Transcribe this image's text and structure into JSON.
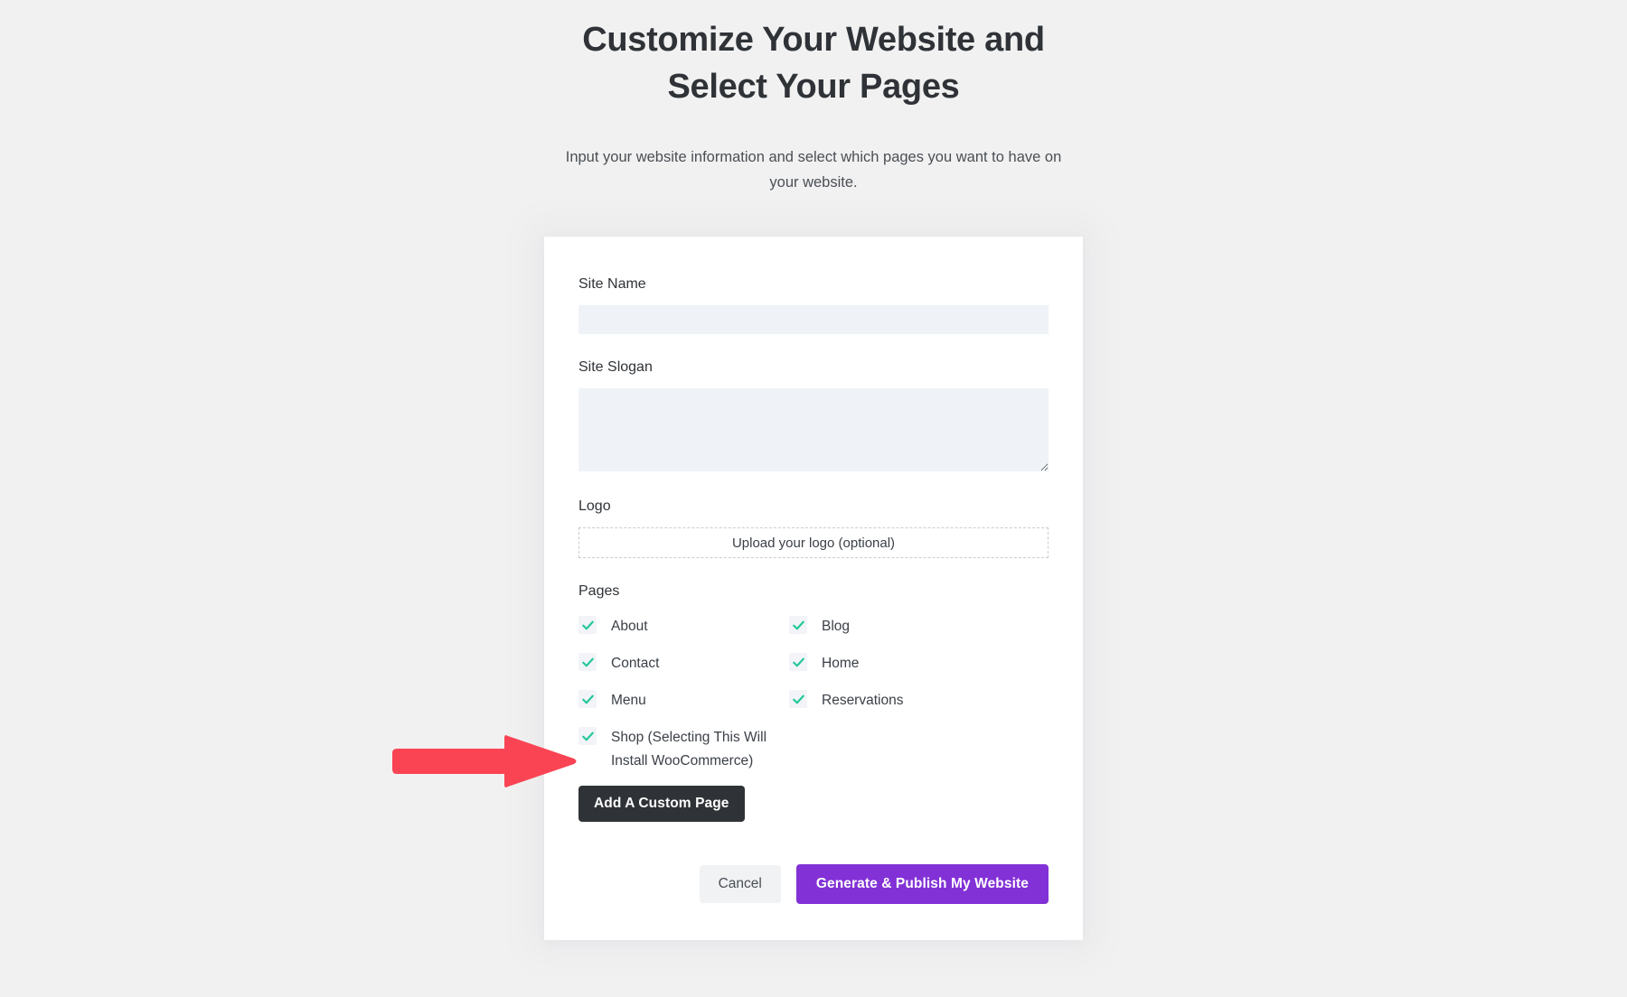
{
  "header": {
    "title": "Customize Your Website and Select Your Pages",
    "subtitle": "Input your website information and select which pages you want to have on your website."
  },
  "form": {
    "site_name": {
      "label": "Site Name",
      "value": "",
      "placeholder": ""
    },
    "site_slogan": {
      "label": "Site Slogan",
      "value": "",
      "placeholder": ""
    },
    "logo": {
      "label": "Logo",
      "upload_label": "Upload your logo (optional)"
    },
    "pages": {
      "label": "Pages",
      "items": [
        {
          "label": "About",
          "checked": true,
          "column": "left"
        },
        {
          "label": "Blog",
          "checked": true,
          "column": "right"
        },
        {
          "label": "Contact",
          "checked": true,
          "column": "left"
        },
        {
          "label": "Home",
          "checked": true,
          "column": "right"
        },
        {
          "label": "Menu",
          "checked": true,
          "column": "left"
        },
        {
          "label": "Reservations",
          "checked": true,
          "column": "right"
        },
        {
          "label": "Shop (Selecting This Will Install WooCommerce)",
          "checked": true,
          "column": "left"
        }
      ]
    },
    "add_custom_page_label": "Add A Custom Page"
  },
  "actions": {
    "cancel_label": "Cancel",
    "generate_label": "Generate & Publish My Website"
  },
  "annotation": {
    "type": "arrow-right",
    "target": "Shop (Selecting This Will Install WooCommerce)",
    "color": "#fa4454"
  },
  "colors": {
    "page_background": "#f1f1f1",
    "card_background": "#ffffff",
    "text_primary": "#2f3337",
    "text_secondary": "#4a4f55",
    "input_background": "#eff2f6",
    "checkbox_background": "#f2f4f8",
    "check_green": "#22c79a",
    "dark_button": "#2f3337",
    "cancel_button": "#f1f2f4",
    "accent_purple": "#8231d6",
    "arrow_red": "#fa4454"
  }
}
